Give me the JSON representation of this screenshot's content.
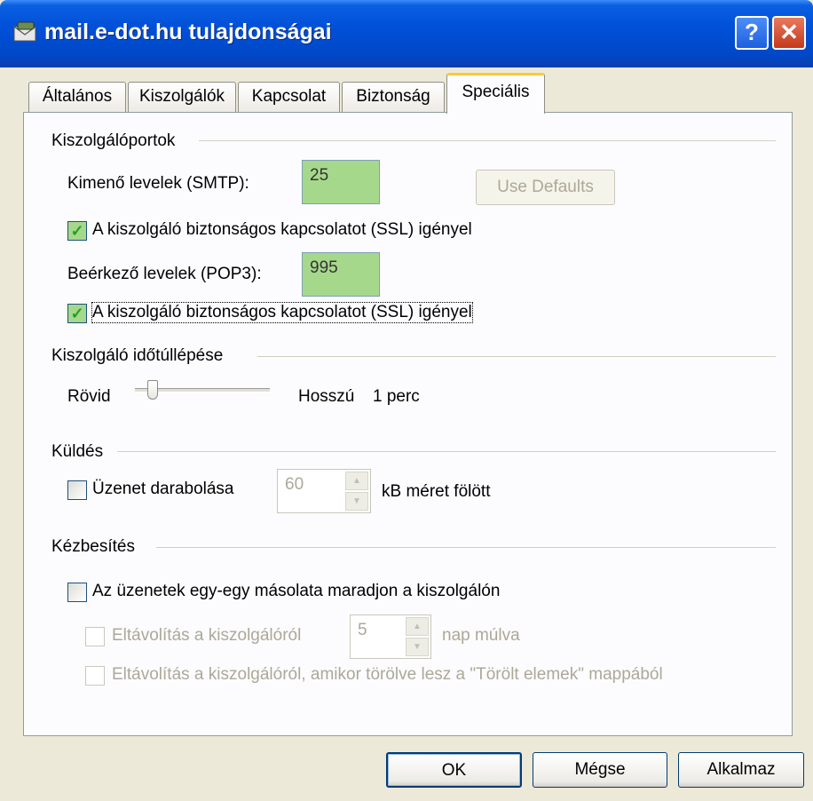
{
  "window": {
    "title": "mail.e-dot.hu tulajdonságai",
    "help_label": "?",
    "close_label": "✕"
  },
  "tabs": [
    {
      "label": "Általános"
    },
    {
      "label": "Kiszolgálók"
    },
    {
      "label": "Kapcsolat"
    },
    {
      "label": "Biztonság"
    },
    {
      "label": "Speciális",
      "active": true
    }
  ],
  "server_ports": {
    "group_label": "Kiszolgálóportok",
    "smtp_label": "Kimenő levelek (SMTP):",
    "smtp_value": "25",
    "use_defaults_label": "Use Defaults",
    "smtp_ssl_label": "A kiszolgáló biztonságos kapcsolatot (SSL) igényel",
    "smtp_ssl_checked": true,
    "pop3_label": "Beérkező levelek (POP3):",
    "pop3_value": "995",
    "pop3_ssl_label": "A kiszolgáló biztonságos kapcsolatot (SSL) igényel",
    "pop3_ssl_checked": true
  },
  "timeout": {
    "group_label": "Kiszolgáló időtúllépése",
    "short_label": "Rövid",
    "long_label": "Hosszú",
    "value_text": "1 perc",
    "slider_fraction": 0.1
  },
  "sending": {
    "group_label": "Küldés",
    "split_label": "Üzenet darabolása",
    "split_checked": false,
    "split_size": "60",
    "split_suffix": "kB méret fölött"
  },
  "delivery": {
    "group_label": "Kézbesítés",
    "keep_copy_label": "Az üzenetek egy-egy másolata maradjon a kiszolgálón",
    "keep_copy_checked": false,
    "remove_after_label": "Eltávolítás a kiszolgálóról",
    "remove_after_days": "5",
    "remove_after_suffix": "nap múlva",
    "remove_deleted_label": "Eltávolítás a kiszolgálóról, amikor törölve lesz a \"Törölt elemek\" mappából"
  },
  "buttons": {
    "ok": "OK",
    "cancel": "Mégse",
    "apply": "Alkalmaz"
  }
}
